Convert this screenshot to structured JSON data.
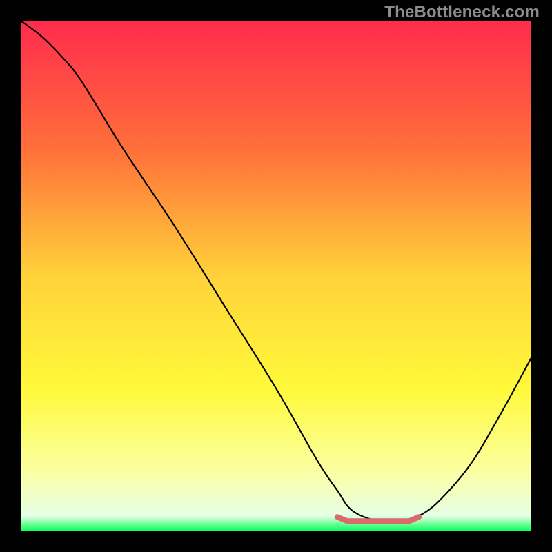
{
  "watermark": "TheBottleneck.com",
  "colors": {
    "gradient_stops": [
      {
        "offset": "0%",
        "color": "#ff2b4d"
      },
      {
        "offset": "25%",
        "color": "#ff6f3a"
      },
      {
        "offset": "50%",
        "color": "#ffd23a"
      },
      {
        "offset": "72%",
        "color": "#fff93a"
      },
      {
        "offset": "88%",
        "color": "#fbffa0"
      },
      {
        "offset": "97%",
        "color": "#e6ffe6"
      },
      {
        "offset": "100%",
        "color": "#00ff55"
      }
    ],
    "curve": "#000000",
    "highlight": "#d96b6b",
    "frame": "#000000"
  },
  "chart_data": {
    "type": "line",
    "title": "",
    "xlabel": "",
    "ylabel": "",
    "xlim": [
      0,
      100
    ],
    "ylim": [
      0,
      100
    ],
    "series": [
      {
        "name": "curve",
        "x": [
          0,
          4,
          8,
          12,
          20,
          30,
          40,
          50,
          58,
          62,
          65,
          70,
          75,
          78,
          82,
          88,
          94,
          100
        ],
        "y": [
          100,
          97,
          93,
          88,
          75,
          60,
          44,
          28,
          14,
          8,
          4,
          2,
          2,
          3,
          6,
          13,
          23,
          34
        ]
      }
    ],
    "highlight_range": {
      "x_start": 62,
      "x_end": 78,
      "y": 2
    }
  }
}
